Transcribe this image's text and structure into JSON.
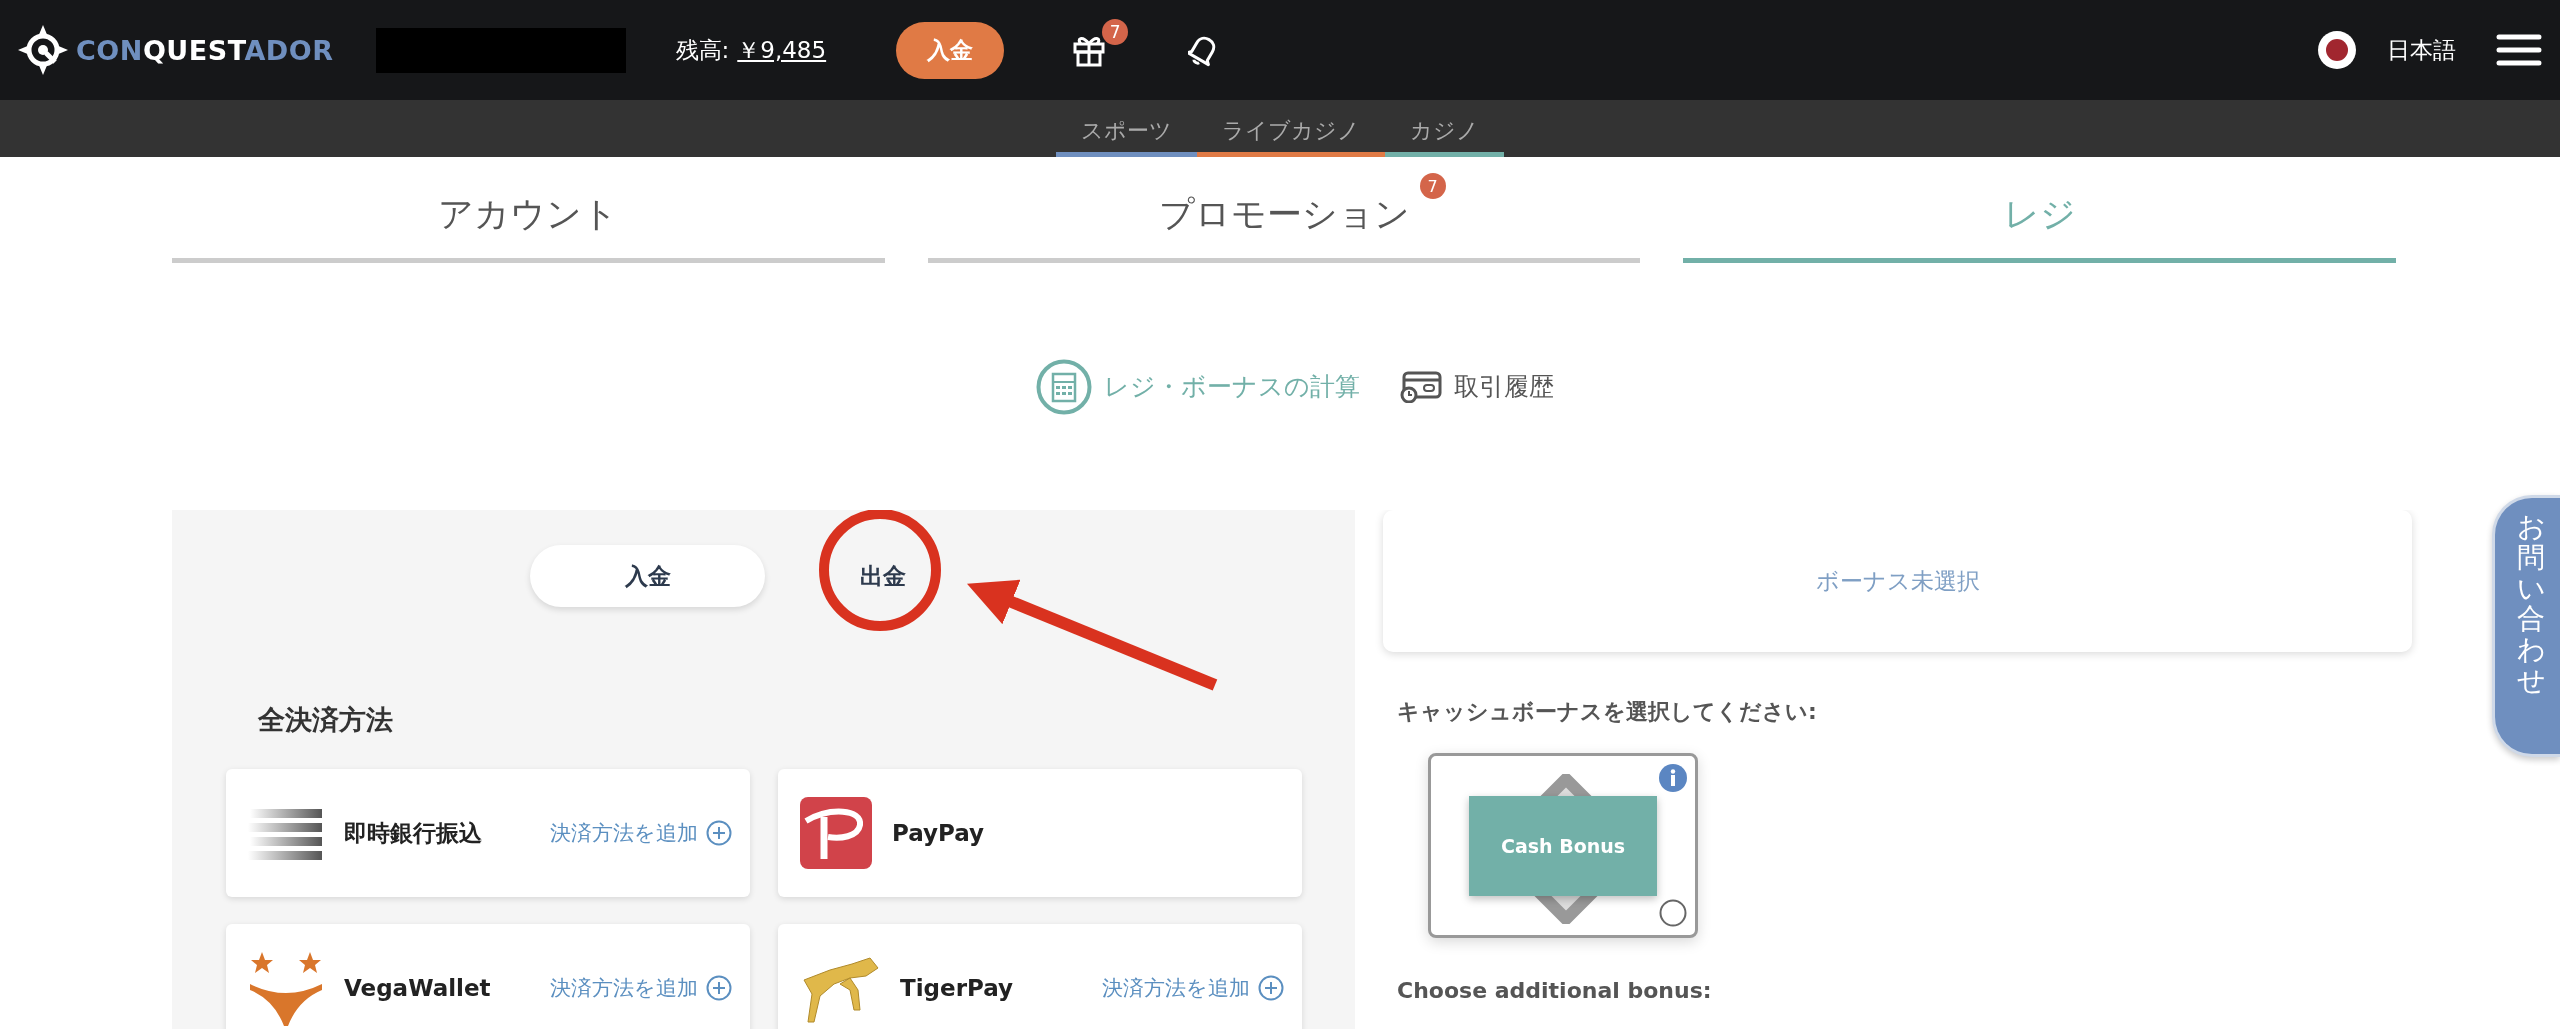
{
  "header": {
    "logo_parts": [
      {
        "text": "CON",
        "accent": true
      },
      {
        "text": "QUEST",
        "accent": false
      },
      {
        "text": "ADOR",
        "accent": true
      }
    ],
    "balance_label": "残高:",
    "balance_value": "￥9,485",
    "deposit_button": "入金",
    "gift_badge": "7",
    "language": "日本語"
  },
  "category_nav": [
    {
      "label": "スポーツ",
      "color": "#6f8fbf"
    },
    {
      "label": "ライブカジノ",
      "color": "#e07a45"
    },
    {
      "label": "カジノ",
      "color": "#72b0a8"
    }
  ],
  "tabs": [
    {
      "label": "アカウント",
      "selected": false
    },
    {
      "label": "プロモーション",
      "selected": false,
      "badge": "7"
    },
    {
      "label": "レジ",
      "selected": true
    }
  ],
  "cashier_links": [
    {
      "label": "レジ・ボーナスの計算",
      "kind": "calculator",
      "selected": true
    },
    {
      "label": "取引履歴",
      "kind": "history",
      "selected": false
    }
  ],
  "mode_toggle": [
    {
      "label": "入金",
      "selected": true
    },
    {
      "label": "出金",
      "selected": false
    }
  ],
  "methods_heading": "全決済方法",
  "payment_methods": [
    {
      "name": "即時銀行振込",
      "kind": "bank",
      "action": "決済方法を追加"
    },
    {
      "name": "PayPay",
      "kind": "paypay"
    },
    {
      "name": "VegaWallet",
      "kind": "vega",
      "action": "決済方法を追加"
    },
    {
      "name": "TigerPay",
      "kind": "tiger",
      "action": "決済方法を追加"
    }
  ],
  "bonus_status": "ボーナス未選択",
  "cash_bonus_prompt": "キャッシュボーナスを選択してください:",
  "bonuses": [
    {
      "label": "Cash Bonus",
      "selected": false
    }
  ],
  "additional_bonus_prompt": "Choose additional bonus:",
  "contact_tab": "お問い合わせ"
}
